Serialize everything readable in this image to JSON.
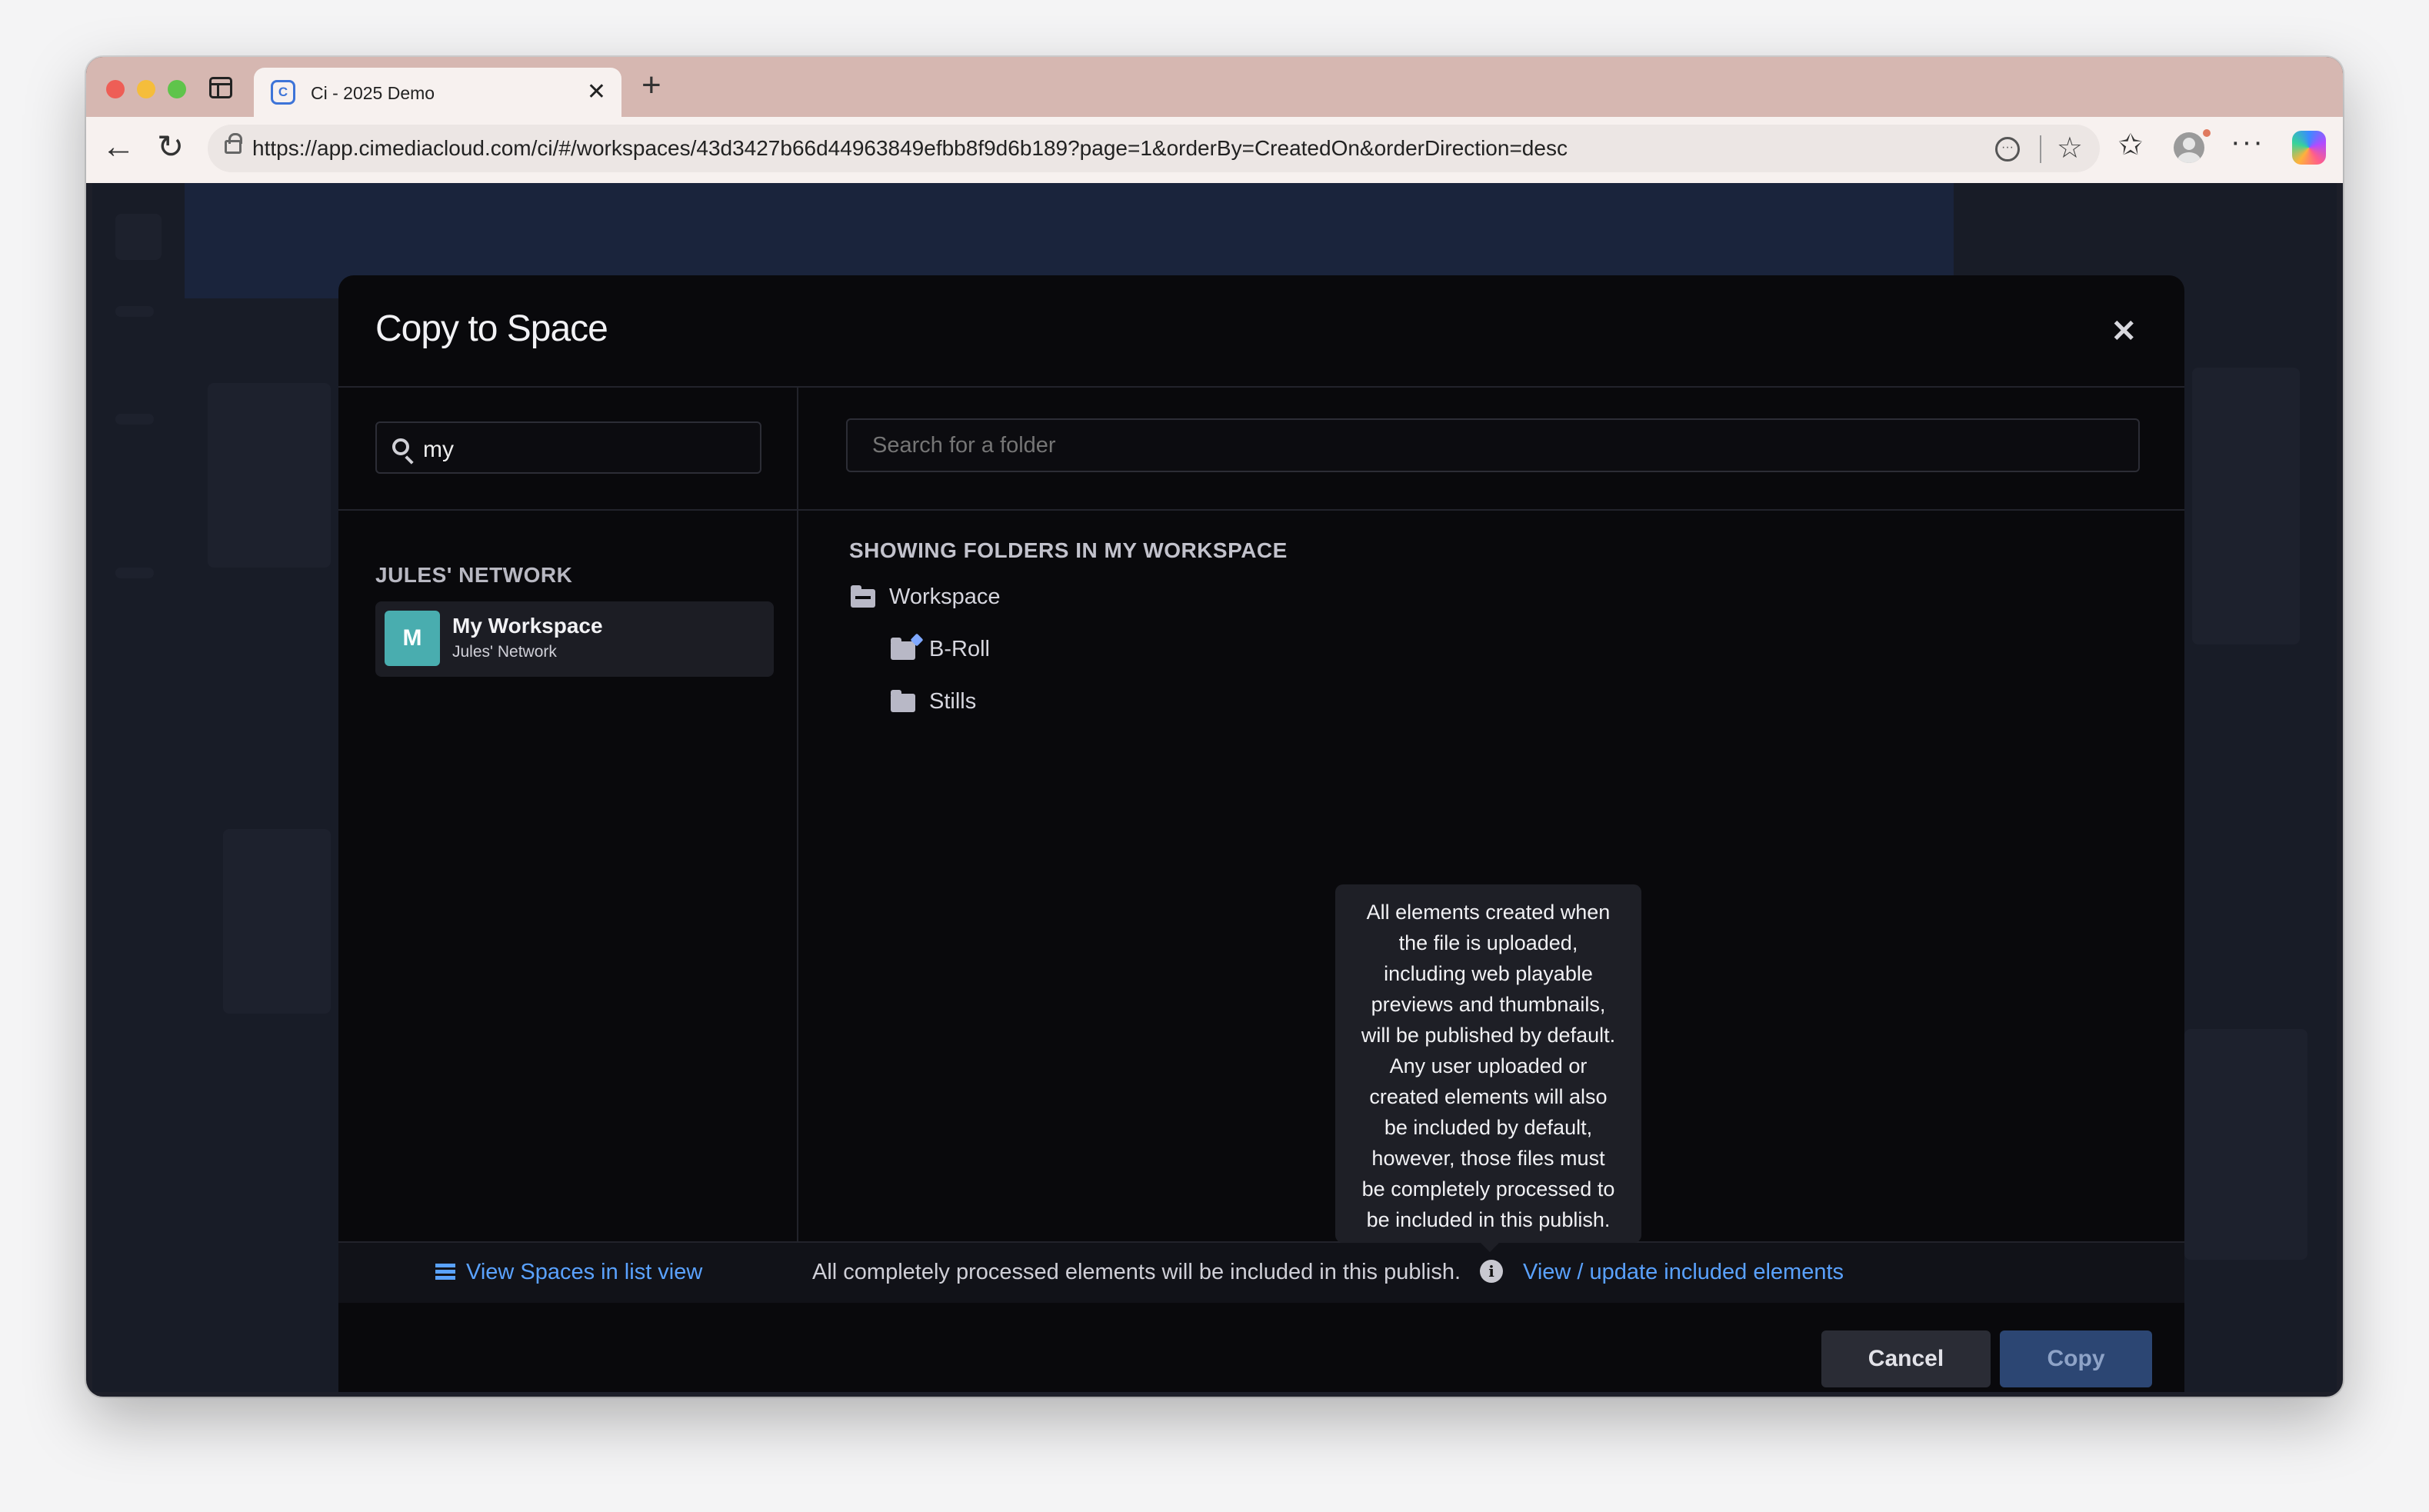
{
  "browser": {
    "tab_title": "Ci - 2025 Demo",
    "tab_favicon_letter": "C",
    "url": "https://app.cimediacloud.com/ci/#/workspaces/43d3427b66d44963849efbb8f9d6b189?page=1&orderBy=CreatedOn&orderDirection=desc"
  },
  "modal": {
    "title": "Copy to Space",
    "space_search_value": "my",
    "folder_search_placeholder": "Search for a folder",
    "network_label": "JULES' NETWORK",
    "space": {
      "avatar_letter": "M",
      "name": "My Workspace",
      "network": "Jules' Network",
      "avatar_color": "#49adaf"
    },
    "showing_label": "SHOWING FOLDERS IN MY WORKSPACE",
    "folders": {
      "root": "Workspace",
      "children": [
        "B-Roll",
        "Stills"
      ]
    },
    "list_view_link": "View Spaces in list view",
    "publish_note": "All completely processed elements will be included in this publish.",
    "update_link": "View / update included elements",
    "tooltip_lines": [
      "All elements created when",
      "the file is uploaded,",
      "including web playable",
      "previews and thumbnails,",
      "will be published by default.",
      "Any user uploaded or",
      "created elements will also",
      "be included by default,",
      "however, those files must",
      "be completely processed to",
      "be included in this publish."
    ],
    "cancel_label": "Cancel",
    "copy_label": "Copy"
  },
  "colors": {
    "link": "#5aa2ff",
    "modal_bg": "#09090c",
    "primary_button": "#2c4673"
  }
}
